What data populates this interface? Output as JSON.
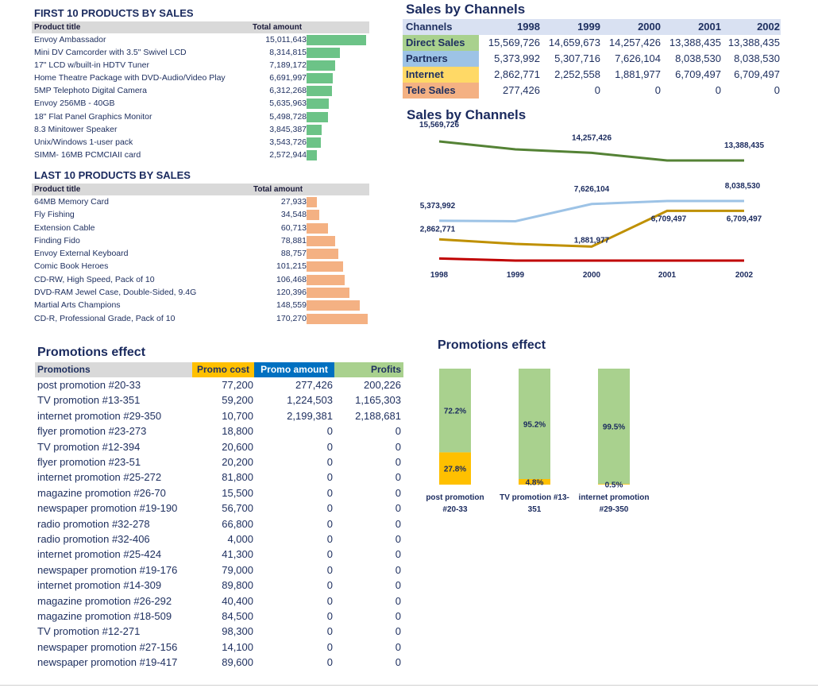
{
  "first10": {
    "title": "FIRST 10 PRODUCTS BY SALES",
    "col_product": "Product title",
    "col_amount": "Total amount",
    "rows": [
      {
        "name": "Envoy Ambassador",
        "amount": "15,011,643",
        "value": 15011643
      },
      {
        "name": "Mini DV Camcorder with 3.5\" Swivel LCD",
        "amount": "8,314,815",
        "value": 8314815
      },
      {
        "name": "17\" LCD w/built-in HDTV Tuner",
        "amount": "7,189,172",
        "value": 7189172
      },
      {
        "name": "Home Theatre Package with DVD-Audio/Video Play",
        "amount": "6,691,997",
        "value": 6691997
      },
      {
        "name": "5MP Telephoto Digital Camera",
        "amount": "6,312,268",
        "value": 6312268
      },
      {
        "name": "Envoy 256MB - 40GB",
        "amount": "5,635,963",
        "value": 5635963
      },
      {
        "name": "18\" Flat Panel Graphics Monitor",
        "amount": "5,498,728",
        "value": 5498728
      },
      {
        "name": "8.3 Minitower Speaker",
        "amount": "3,845,387",
        "value": 3845387
      },
      {
        "name": "Unix/Windows 1-user pack",
        "amount": "3,543,726",
        "value": 3543726
      },
      {
        "name": "SIMM- 16MB PCMCIAII card",
        "amount": "2,572,944",
        "value": 2572944
      }
    ],
    "bar_color": "#6cc387"
  },
  "last10": {
    "title": "LAST 10 PRODUCTS BY SALES",
    "col_product": "Product title",
    "col_amount": "Total amount",
    "rows": [
      {
        "name": "64MB Memory Card",
        "amount": "27,933",
        "value": 27933
      },
      {
        "name": "Fly Fishing",
        "amount": "34,548",
        "value": 34548
      },
      {
        "name": "Extension Cable",
        "amount": "60,713",
        "value": 60713
      },
      {
        "name": "Finding Fido",
        "amount": "78,881",
        "value": 78881
      },
      {
        "name": "Envoy External Keyboard",
        "amount": "88,757",
        "value": 88757
      },
      {
        "name": "Comic Book Heroes",
        "amount": "101,215",
        "value": 101215
      },
      {
        "name": "CD-RW, High Speed, Pack of 10",
        "amount": "106,468",
        "value": 106468
      },
      {
        "name": "DVD-RAM Jewel Case, Double-Sided, 9.4G",
        "amount": "120,396",
        "value": 120396
      },
      {
        "name": "Martial Arts Champions",
        "amount": "148,559",
        "value": 148559
      },
      {
        "name": "CD-R, Professional Grade, Pack of 10",
        "amount": "170,270",
        "value": 170270
      }
    ],
    "bar_color": "#f4b183"
  },
  "channels": {
    "title": "Sales by Channels",
    "header_label": "Channels",
    "years": [
      "1998",
      "1999",
      "2000",
      "2001",
      "2002"
    ],
    "rows": [
      {
        "label": "Direct Sales",
        "color": "#a9d18e",
        "values": [
          "15,569,726",
          "14,659,673",
          "14,257,426",
          "13,388,435",
          "13,388,435"
        ]
      },
      {
        "label": "Partners",
        "color": "#9dc3e6",
        "values": [
          "5,373,992",
          "5,307,716",
          "7,626,104",
          "8,038,530",
          "8,038,530"
        ]
      },
      {
        "label": "Internet",
        "color": "#ffd966",
        "values": [
          "2,862,771",
          "2,252,558",
          "1,881,977",
          "6,709,497",
          "6,709,497"
        ]
      },
      {
        "label": "Tele Sales",
        "color": "#f4b183",
        "values": [
          "277,426",
          "0",
          "0",
          "0",
          "0"
        ]
      }
    ]
  },
  "chart_data": [
    {
      "type": "line",
      "title": "Sales by Channels",
      "x": [
        "1998",
        "1999",
        "2000",
        "2001",
        "2002"
      ],
      "series": [
        {
          "values": [
            15569726,
            14659673,
            14257426,
            13388435,
            13388435
          ],
          "color": "#548235",
          "labels": [
            "15,569,726",
            "",
            "14,257,426",
            "",
            "13,388,435"
          ]
        },
        {
          "values": [
            5373992,
            5307716,
            7626104,
            8038530,
            8038530
          ],
          "color": "#9dc3e6",
          "labels": [
            "5,373,992",
            "",
            "7,626,104",
            "",
            "8,038,530"
          ]
        },
        {
          "values": [
            2862771,
            2252558,
            1881977,
            6709497,
            6709497
          ],
          "color": "#bf9000",
          "labels": [
            "2,862,771",
            "",
            "1,881,977",
            "6,709,497",
            "6,709,497"
          ]
        },
        {
          "values": [
            277426,
            0,
            0,
            0,
            0
          ],
          "color": "#c00000",
          "labels": [
            "",
            "",
            "",
            "",
            ""
          ]
        }
      ],
      "grid": false
    },
    {
      "type": "bar",
      "title": "Promotions effect",
      "stacked": "100%",
      "categories": [
        "post promotion #20-33",
        "TV promotion #13-351",
        "internet promotion #29-350"
      ],
      "category_lines": [
        [
          "post promotion",
          "#20-33"
        ],
        [
          "TV promotion #13-",
          "351"
        ],
        [
          "internet promotion",
          "#29-350"
        ]
      ],
      "series": [
        {
          "values": [
            27.8,
            4.8,
            0.5
          ],
          "labels": [
            "27.8%",
            "4.8%",
            "0.5%"
          ],
          "color": "#ffc000"
        },
        {
          "values": [
            72.2,
            95.2,
            99.5
          ],
          "labels": [
            "72.2%",
            "95.2%",
            "99.5%"
          ],
          "color": "#a9d18e"
        }
      ]
    }
  ],
  "promotions": {
    "title": "Promotions effect",
    "headers": {
      "promotions": "Promotions",
      "promo_cost": "Promo cost",
      "promo_amount": "Promo amount",
      "profits": "Profits"
    },
    "header_colors": {
      "promo_cost": "#ffc000",
      "promo_amount": "#0070c0",
      "profits": "#a9d18e"
    },
    "rows": [
      {
        "name": "post promotion #20-33",
        "cost": "77,200",
        "amount": "277,426",
        "profit": "200,226"
      },
      {
        "name": "TV promotion #13-351",
        "cost": "59,200",
        "amount": "1,224,503",
        "profit": "1,165,303"
      },
      {
        "name": "internet promotion #29-350",
        "cost": "10,700",
        "amount": "2,199,381",
        "profit": "2,188,681"
      },
      {
        "name": "flyer promotion #23-273",
        "cost": "18,800",
        "amount": "0",
        "profit": "0"
      },
      {
        "name": "TV promotion #12-394",
        "cost": "20,600",
        "amount": "0",
        "profit": "0"
      },
      {
        "name": "flyer promotion #23-51",
        "cost": "20,200",
        "amount": "0",
        "profit": "0"
      },
      {
        "name": "internet promotion #25-272",
        "cost": "81,800",
        "amount": "0",
        "profit": "0"
      },
      {
        "name": "magazine promotion #26-70",
        "cost": "15,500",
        "amount": "0",
        "profit": "0"
      },
      {
        "name": "newspaper promotion #19-190",
        "cost": "56,700",
        "amount": "0",
        "profit": "0"
      },
      {
        "name": "radio promotion #32-278",
        "cost": "66,800",
        "amount": "0",
        "profit": "0"
      },
      {
        "name": "radio promotion #32-406",
        "cost": "4,000",
        "amount": "0",
        "profit": "0"
      },
      {
        "name": "internet promotion #25-424",
        "cost": "41,300",
        "amount": "0",
        "profit": "0"
      },
      {
        "name": "newspaper promotion #19-176",
        "cost": "79,000",
        "amount": "0",
        "profit": "0"
      },
      {
        "name": "internet promotion #14-309",
        "cost": "89,800",
        "amount": "0",
        "profit": "0"
      },
      {
        "name": "magazine promotion #26-292",
        "cost": "40,400",
        "amount": "0",
        "profit": "0"
      },
      {
        "name": "magazine promotion #18-509",
        "cost": "84,500",
        "amount": "0",
        "profit": "0"
      },
      {
        "name": "TV promotion #12-271",
        "cost": "98,300",
        "amount": "0",
        "profit": "0"
      },
      {
        "name": "newspaper promotion #27-156",
        "cost": "14,100",
        "amount": "0",
        "profit": "0"
      },
      {
        "name": "newspaper promotion #19-417",
        "cost": "89,600",
        "amount": "0",
        "profit": "0"
      }
    ]
  },
  "promo_chart": {
    "title": "Promotions effect"
  }
}
